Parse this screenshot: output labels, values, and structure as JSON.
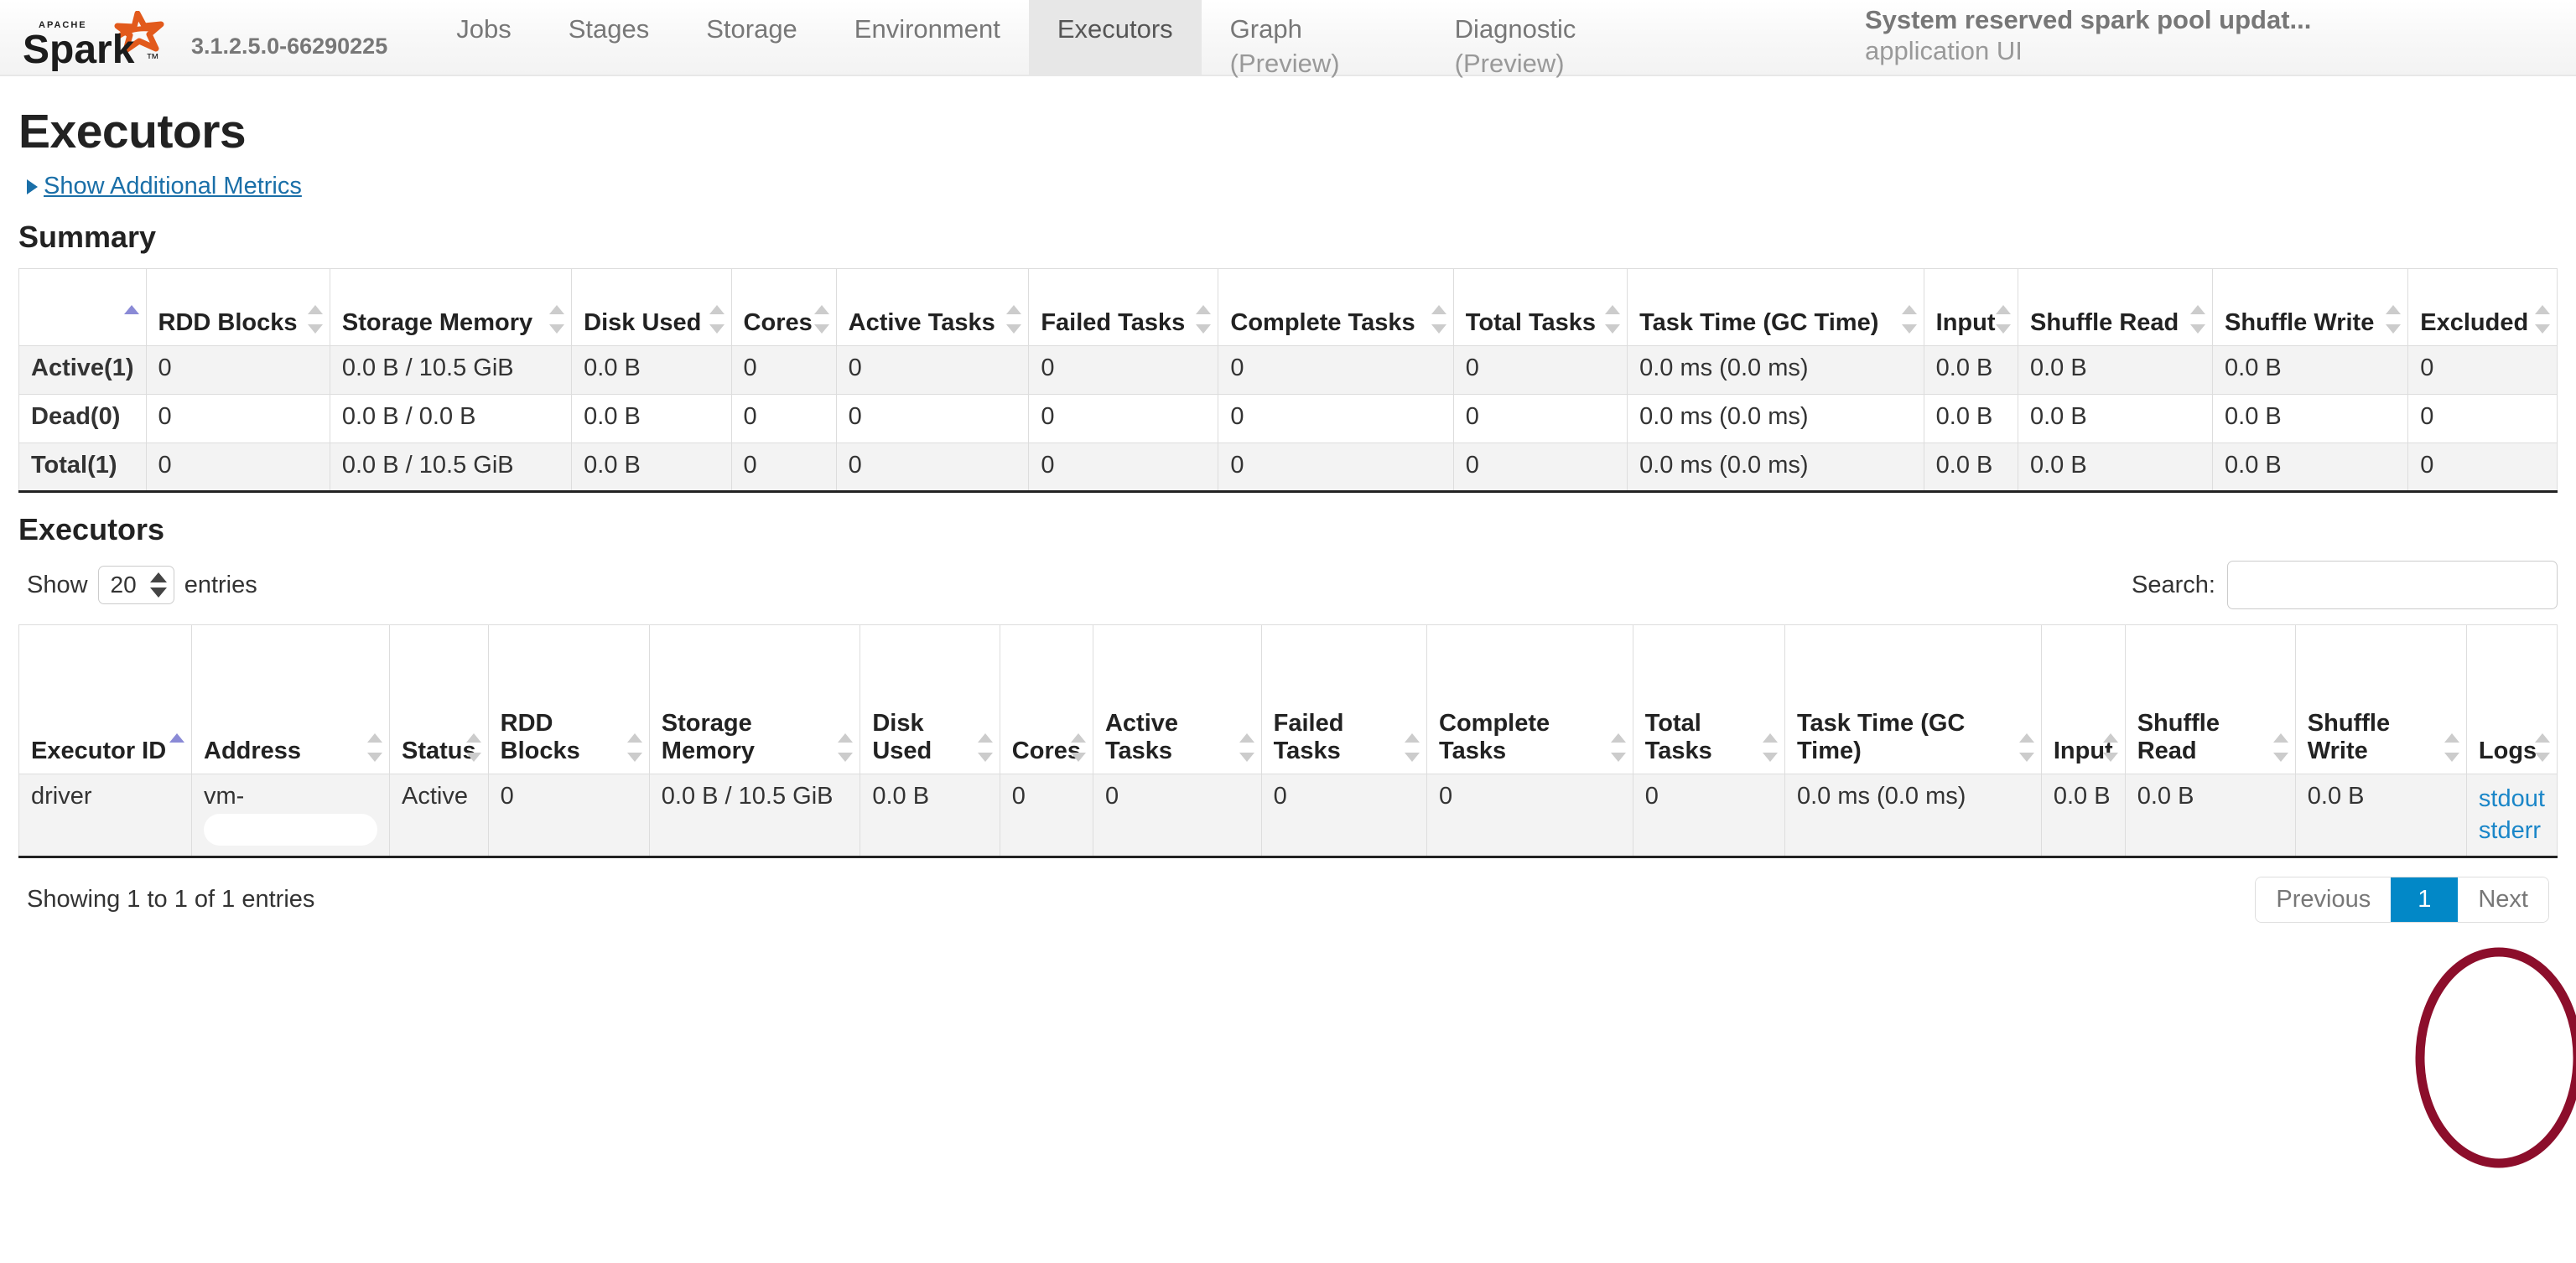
{
  "navbar": {
    "logo_alt": "Apache Spark",
    "version": "3.1.2.5.0-66290225",
    "tabs": [
      {
        "label": "Jobs",
        "sub": "",
        "active": false
      },
      {
        "label": "Stages",
        "sub": "",
        "active": false
      },
      {
        "label": "Storage",
        "sub": "",
        "active": false
      },
      {
        "label": "Environment",
        "sub": "",
        "active": false
      },
      {
        "label": "Executors",
        "sub": "",
        "active": true
      },
      {
        "label": "Graph",
        "sub": "(Preview)",
        "active": false
      },
      {
        "label": "Diagnostic",
        "sub": "(Preview)",
        "active": false
      }
    ],
    "app_name": "System reserved spark pool updat...",
    "app_subtitle": "application UI"
  },
  "page": {
    "title": "Executors",
    "additional_metrics_label": "Show Additional Metrics",
    "summary_heading": "Summary",
    "executors_heading": "Executors"
  },
  "summary_table": {
    "headers": [
      "",
      "RDD Blocks",
      "Storage Memory",
      "Disk Used",
      "Cores",
      "Active Tasks",
      "Failed Tasks",
      "Complete Tasks",
      "Total Tasks",
      "Task Time (GC Time)",
      "Input",
      "Shuffle Read",
      "Shuffle Write",
      "Excluded"
    ],
    "rows": [
      {
        "label": "Active(1)",
        "cells": [
          "0",
          "0.0 B / 10.5 GiB",
          "0.0 B",
          "0",
          "0",
          "0",
          "0",
          "0",
          "0.0 ms (0.0 ms)",
          "0.0 B",
          "0.0 B",
          "0.0 B",
          "0"
        ]
      },
      {
        "label": "Dead(0)",
        "cells": [
          "0",
          "0.0 B / 0.0 B",
          "0.0 B",
          "0",
          "0",
          "0",
          "0",
          "0",
          "0.0 ms (0.0 ms)",
          "0.0 B",
          "0.0 B",
          "0.0 B",
          "0"
        ]
      },
      {
        "label": "Total(1)",
        "cells": [
          "0",
          "0.0 B / 10.5 GiB",
          "0.0 B",
          "0",
          "0",
          "0",
          "0",
          "0",
          "0.0 ms (0.0 ms)",
          "0.0 B",
          "0.0 B",
          "0.0 B",
          "0"
        ]
      }
    ]
  },
  "controls": {
    "show_label": "Show",
    "entries_label": "entries",
    "page_size": "20",
    "search_label": "Search:",
    "search_value": "",
    "search_placeholder": ""
  },
  "executors_table": {
    "headers": [
      "Executor ID",
      "Address",
      "Status",
      "RDD Blocks",
      "Storage Memory",
      "Disk Used",
      "Cores",
      "Active Tasks",
      "Failed Tasks",
      "Complete Tasks",
      "Total Tasks",
      "Task Time (GC Time)",
      "Input",
      "Shuffle Read",
      "Shuffle Write",
      "Logs"
    ],
    "rows": [
      {
        "executor_id": "driver",
        "address": "vm-",
        "address_redacted": true,
        "status": "Active",
        "rdd_blocks": "0",
        "storage_memory": "0.0 B / 10.5 GiB",
        "disk_used": "0.0 B",
        "cores": "0",
        "active_tasks": "0",
        "failed_tasks": "0",
        "complete_tasks": "0",
        "total_tasks": "0",
        "task_time": "0.0 ms (0.0 ms)",
        "input": "0.0 B",
        "shuffle_read": "0.0 B",
        "shuffle_write": "0.0 B",
        "logs": [
          "stdout",
          "stderr"
        ]
      }
    ]
  },
  "footer": {
    "showing_text": "Showing 1 to 1 of 1 entries",
    "previous_label": "Previous",
    "page_number": "1",
    "next_label": "Next"
  },
  "annotation": {
    "shape": "ellipse",
    "color": "#8c0e2b",
    "target": "Logs column"
  },
  "colors": {
    "accent_blue": "#0288c7",
    "link_blue": "#1a86c8",
    "annotation_red": "#8c0e2b",
    "spark_orange": "#e25a1c"
  }
}
